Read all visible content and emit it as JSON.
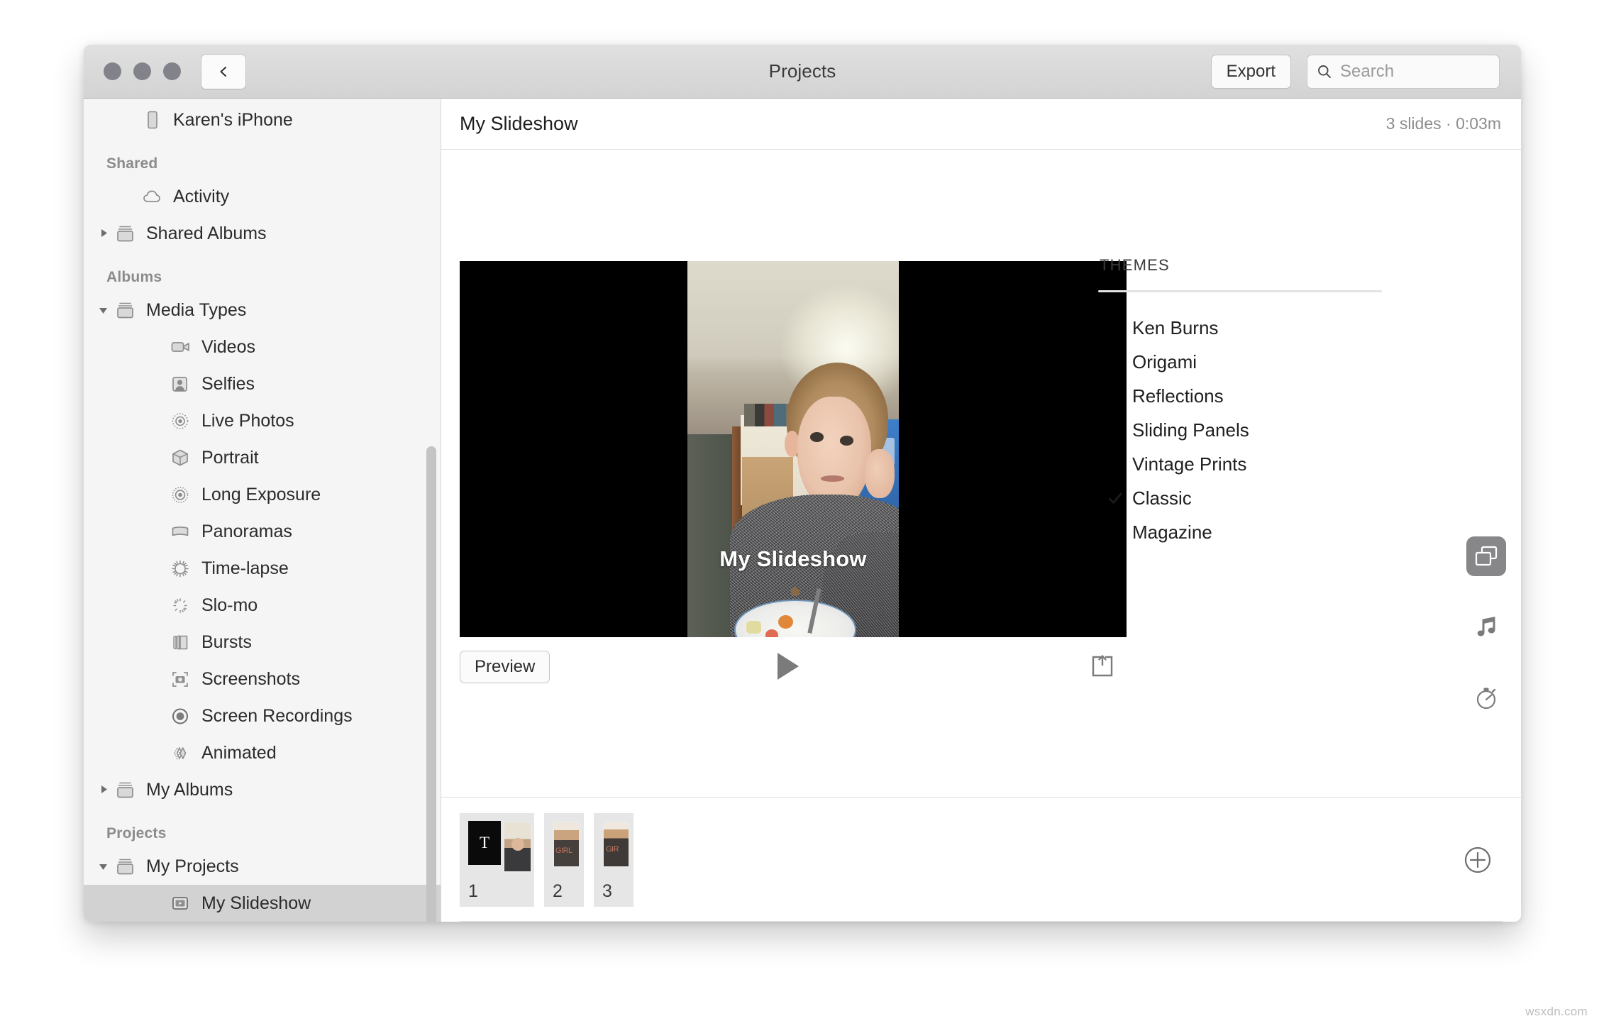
{
  "window": {
    "title": "Projects",
    "back_icon": "chevron-left-icon",
    "traffic_lights": [
      "close-button",
      "minimize-button",
      "zoom-button"
    ]
  },
  "toolbar": {
    "export_label": "Export",
    "search_placeholder": "Search",
    "search_value": "",
    "search_icon": "search-icon"
  },
  "sidebar": {
    "sections": [
      {
        "header": null,
        "items": [
          {
            "label": "Karen's iPhone",
            "icon": "iphone-icon",
            "indent": 1,
            "twisty": null,
            "selected": false
          }
        ]
      },
      {
        "header": "Shared",
        "items": [
          {
            "label": "Activity",
            "icon": "cloud-icon",
            "indent": 1,
            "twisty": null,
            "selected": false
          },
          {
            "label": "Shared Albums",
            "icon": "album-stack-icon",
            "indent": 0,
            "twisty": "collapsed",
            "selected": false
          }
        ]
      },
      {
        "header": "Albums",
        "items": [
          {
            "label": "Media Types",
            "icon": "album-stack-icon",
            "indent": 0,
            "twisty": "expanded",
            "selected": false
          },
          {
            "label": "Videos",
            "icon": "video-camera-icon",
            "indent": 2,
            "twisty": null,
            "selected": false
          },
          {
            "label": "Selfies",
            "icon": "person-portrait-icon",
            "indent": 2,
            "twisty": null,
            "selected": false
          },
          {
            "label": "Live Photos",
            "icon": "live-photo-icon",
            "indent": 2,
            "twisty": null,
            "selected": false
          },
          {
            "label": "Portrait",
            "icon": "cube-icon",
            "indent": 2,
            "twisty": null,
            "selected": false
          },
          {
            "label": "Long Exposure",
            "icon": "long-exposure-icon",
            "indent": 2,
            "twisty": null,
            "selected": false
          },
          {
            "label": "Panoramas",
            "icon": "panorama-icon",
            "indent": 2,
            "twisty": null,
            "selected": false
          },
          {
            "label": "Time-lapse",
            "icon": "timelapse-icon",
            "indent": 2,
            "twisty": null,
            "selected": false
          },
          {
            "label": "Slo-mo",
            "icon": "slomo-icon",
            "indent": 2,
            "twisty": null,
            "selected": false
          },
          {
            "label": "Bursts",
            "icon": "bursts-icon",
            "indent": 2,
            "twisty": null,
            "selected": false
          },
          {
            "label": "Screenshots",
            "icon": "screenshot-camera-icon",
            "indent": 2,
            "twisty": null,
            "selected": false
          },
          {
            "label": "Screen Recordings",
            "icon": "screen-recording-icon",
            "indent": 2,
            "twisty": null,
            "selected": false
          },
          {
            "label": "Animated",
            "icon": "animated-icon",
            "indent": 2,
            "twisty": null,
            "selected": false
          },
          {
            "label": "My Albums",
            "icon": "album-stack-icon",
            "indent": 0,
            "twisty": "collapsed",
            "selected": false
          }
        ]
      },
      {
        "header": "Projects",
        "items": [
          {
            "label": "My Projects",
            "icon": "album-stack-icon",
            "indent": 0,
            "twisty": "expanded",
            "selected": false
          },
          {
            "label": "My Slideshow",
            "icon": "slideshow-icon",
            "indent": 2,
            "twisty": null,
            "selected": true
          }
        ]
      }
    ]
  },
  "project": {
    "title": "My Slideshow",
    "meta": "3 slides · 0:03m"
  },
  "preview": {
    "slide_title": "My Slideshow",
    "preview_button": "Preview",
    "play_icon": "play-icon",
    "share_icon": "share-export-icon",
    "letterbox_color": "#000000"
  },
  "themes": {
    "header": "THEMES",
    "selected": "Classic",
    "check_icon": "checkmark-icon",
    "items": [
      {
        "label": "Ken Burns",
        "checked": false
      },
      {
        "label": "Origami",
        "checked": false
      },
      {
        "label": "Reflections",
        "checked": false
      },
      {
        "label": "Sliding Panels",
        "checked": false
      },
      {
        "label": "Vintage Prints",
        "checked": false
      },
      {
        "label": "Classic",
        "checked": true
      },
      {
        "label": "Magazine",
        "checked": false
      }
    ]
  },
  "rail": {
    "buttons": [
      {
        "icon": "themes-cards-icon",
        "name": "themes-tool",
        "active": true
      },
      {
        "icon": "music-note-icon",
        "name": "music-tool",
        "active": false
      },
      {
        "icon": "stopwatch-icon",
        "name": "duration-tool",
        "active": false
      }
    ]
  },
  "slides_strip": {
    "add_icon": "plus-circle-icon",
    "slides": [
      {
        "number": "1",
        "has_text_tile": true,
        "text_tile_glyph": "T"
      },
      {
        "number": "2",
        "has_text_tile": false,
        "text_tile_glyph": ""
      },
      {
        "number": "3",
        "has_text_tile": false,
        "text_tile_glyph": ""
      }
    ]
  },
  "watermark": "wsxdn.com",
  "colors": {
    "titlebar_top": "#e0e0e0",
    "titlebar_bottom": "#d3d3d3",
    "sidebar_bg": "#f5f5f5",
    "selection": "#d2d2d2",
    "rail_active": "#87878a"
  }
}
